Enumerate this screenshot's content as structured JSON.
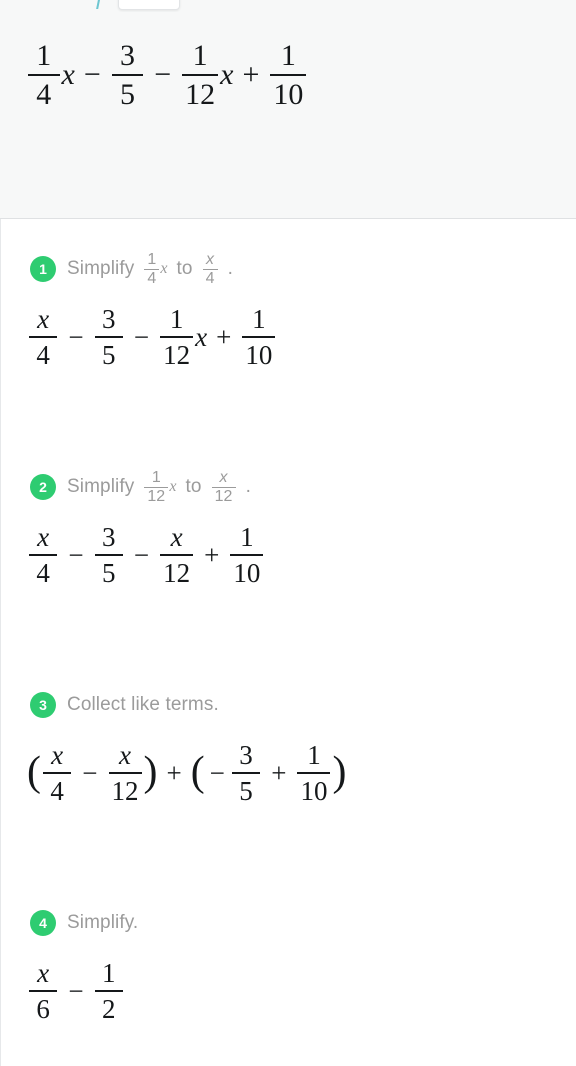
{
  "toolbar": {
    "icon": "math-app-icon",
    "pill_label": ""
  },
  "problem": {
    "label": "problem-expression",
    "expression": "1/4 x - 3/5 - 1/12 x + 1/10",
    "terms": [
      {
        "type": "frac",
        "num": "1",
        "den": "4",
        "suffix": "x"
      },
      {
        "type": "op",
        "value": "−"
      },
      {
        "type": "frac",
        "num": "3",
        "den": "5",
        "suffix": ""
      },
      {
        "type": "op",
        "value": "−"
      },
      {
        "type": "frac",
        "num": "1",
        "den": "12",
        "suffix": "x"
      },
      {
        "type": "op",
        "value": "+"
      },
      {
        "type": "frac",
        "num": "1",
        "den": "10",
        "suffix": ""
      }
    ]
  },
  "colors": {
    "badge_green": "#2ecc71",
    "label_gray": "#9b9b9b",
    "math_black": "#15181a",
    "panel_bg": "#f7f8f8",
    "divider": "#dfe1e3"
  },
  "steps": [
    {
      "number": "1",
      "label_prefix": "Simplify",
      "label_middle": "to",
      "label_suffix": ".",
      "from": {
        "num": "1",
        "den": "4",
        "suffix": "x"
      },
      "to": {
        "num": "x",
        "den": "4",
        "suffix": ""
      },
      "expression": "x/4 - 3/5 - 1/12 x + 1/10",
      "terms": [
        {
          "type": "frac",
          "num": "x",
          "den": "4",
          "suffix": "",
          "italic_num": true
        },
        {
          "type": "op",
          "value": "−"
        },
        {
          "type": "frac",
          "num": "3",
          "den": "5",
          "suffix": ""
        },
        {
          "type": "op",
          "value": "−"
        },
        {
          "type": "frac",
          "num": "1",
          "den": "12",
          "suffix": "x"
        },
        {
          "type": "op",
          "value": "+"
        },
        {
          "type": "frac",
          "num": "1",
          "den": "10",
          "suffix": ""
        }
      ]
    },
    {
      "number": "2",
      "label_prefix": "Simplify",
      "label_middle": "to",
      "label_suffix": ".",
      "from": {
        "num": "1",
        "den": "12",
        "suffix": "x"
      },
      "to": {
        "num": "x",
        "den": "12",
        "suffix": ""
      },
      "expression": "x/4 - 3/5 - x/12 + 1/10",
      "terms": [
        {
          "type": "frac",
          "num": "x",
          "den": "4",
          "suffix": "",
          "italic_num": true
        },
        {
          "type": "op",
          "value": "−"
        },
        {
          "type": "frac",
          "num": "3",
          "den": "5",
          "suffix": ""
        },
        {
          "type": "op",
          "value": "−"
        },
        {
          "type": "frac",
          "num": "x",
          "den": "12",
          "suffix": "",
          "italic_num": true
        },
        {
          "type": "op",
          "value": "+"
        },
        {
          "type": "frac",
          "num": "1",
          "den": "10",
          "suffix": ""
        }
      ]
    },
    {
      "number": "3",
      "label_prefix": "Collect like terms.",
      "label_middle": "",
      "label_suffix": "",
      "expression": "(x/4 - x/12) + (-3/5 + 1/10)"
    },
    {
      "number": "4",
      "label_prefix": "Simplify.",
      "label_middle": "",
      "label_suffix": "",
      "expression": "x/6 - 1/2",
      "terms": [
        {
          "type": "frac",
          "num": "x",
          "den": "6",
          "suffix": "",
          "italic_num": true
        },
        {
          "type": "op",
          "value": "−"
        },
        {
          "type": "frac",
          "num": "1",
          "den": "2",
          "suffix": ""
        }
      ]
    }
  ],
  "step3_groups": {
    "open1": "(",
    "g1": [
      {
        "num": "x",
        "den": "4",
        "italic_num": true
      },
      {
        "op": "−"
      },
      {
        "num": "x",
        "den": "12",
        "italic_num": true
      }
    ],
    "close1": ")",
    "join": "+",
    "open2": "(",
    "lead_sign": "−",
    "g2": [
      {
        "num": "3",
        "den": "5"
      },
      {
        "op": "+"
      },
      {
        "num": "1",
        "den": "10"
      }
    ],
    "close2": ")"
  }
}
